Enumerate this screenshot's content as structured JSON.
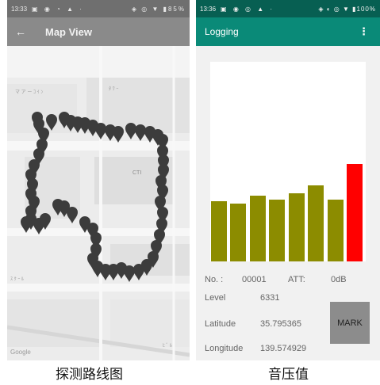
{
  "map_screen": {
    "status_bar": {
      "time": "13:33",
      "left_icons": "▣ ◉ ◔ ▲ ·",
      "right_icons": "◈ ◎ ▼ ▮85%"
    },
    "app_bar": {
      "back_icon": "arrow-back-icon",
      "back_glyph": "←",
      "title": "Map View"
    },
    "map_labels": [
      "Google"
    ],
    "marker_color": "#3c3c3c",
    "caption": "探测路线图"
  },
  "logging_screen": {
    "status_bar": {
      "time": "13:36",
      "left_icons": "▣ ◉ ◎ ▲ ·",
      "right_icons": "◈ ◐ ◎ ▼ ▮100%"
    },
    "app_bar": {
      "title": "Logging",
      "menu_glyph": "⋮",
      "menu_icon": "overflow-menu-icon"
    },
    "chart_data": {
      "type": "bar",
      "values": [
        0.3,
        0.29,
        0.33,
        0.31,
        0.34,
        0.38,
        0.31,
        0.49
      ],
      "colors": [
        "#8c8c00",
        "#8c8c00",
        "#8c8c00",
        "#8c8c00",
        "#8c8c00",
        "#8c8c00",
        "#8c8c00",
        "#ff0000"
      ]
    },
    "info": {
      "no_label": "No. :",
      "no_value": "00001",
      "att_label": "ATT:",
      "att_value": "0dB",
      "level_label": "Level",
      "level_value": "6331",
      "latitude_label": "Latitude",
      "latitude_value": "35.795365",
      "longitude_label": "Longitude",
      "longitude_value": "139.574929"
    },
    "mark_button": "MARK",
    "accent_color": "#0a8a78",
    "caption": "音压值"
  }
}
